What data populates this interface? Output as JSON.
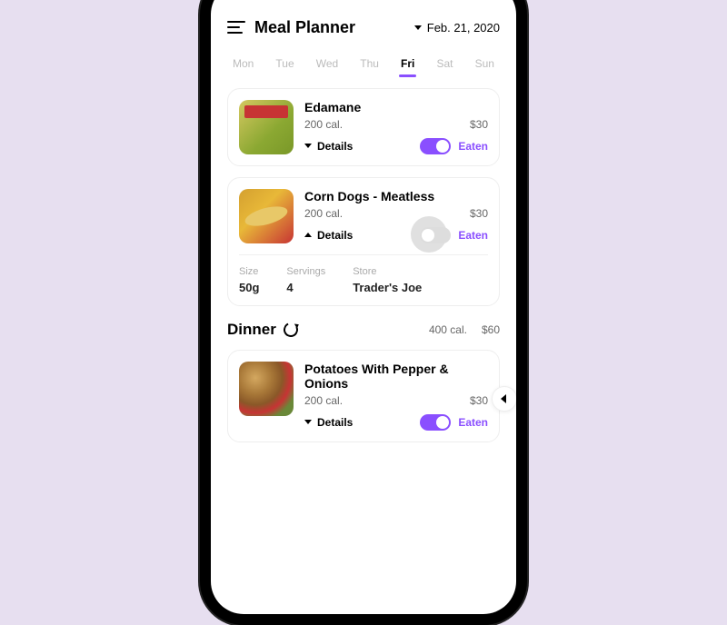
{
  "header": {
    "title": "Meal Planner",
    "date": "Feb. 21, 2020"
  },
  "days": [
    "Mon",
    "Tue",
    "Wed",
    "Thu",
    "Fri",
    "Sat",
    "Sun"
  ],
  "active_day_index": 4,
  "meals": [
    {
      "name": "Edamane",
      "calories": "200 cal.",
      "price": "$30",
      "details_label": "Details",
      "eaten_label": "Eaten",
      "expanded": false,
      "toggle_on": true
    },
    {
      "name": "Corn Dogs - Meatless",
      "calories": "200 cal.",
      "price": "$30",
      "details_label": "Details",
      "eaten_label": "Eaten",
      "expanded": true,
      "toggle_on": false,
      "extra": {
        "size_label": "Size",
        "size": "50g",
        "servings_label": "Servings",
        "servings": "4",
        "store_label": "Store",
        "store": "Trader's Joe"
      }
    }
  ],
  "dinner_section": {
    "title": "Dinner",
    "calories": "400 cal.",
    "price": "$60"
  },
  "dinner_meals": [
    {
      "name": "Potatoes With Pepper & Onions",
      "calories": "200 cal.",
      "price": "$30",
      "details_label": "Details",
      "eaten_label": "Eaten",
      "toggle_on": true
    }
  ]
}
